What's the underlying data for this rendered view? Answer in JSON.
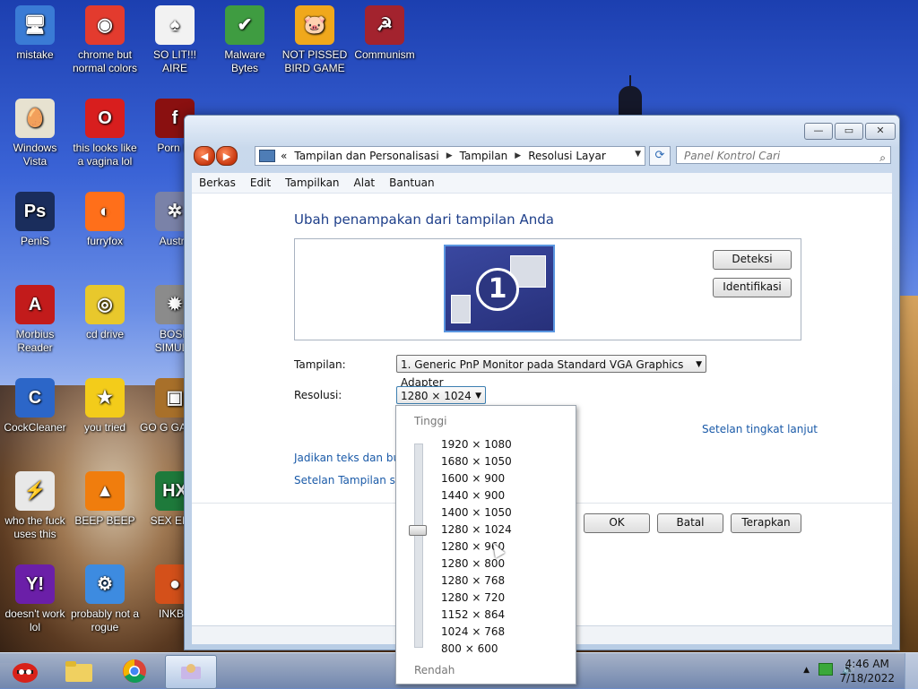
{
  "desktop": {
    "icons": [
      {
        "label": "mistake",
        "color": "#3a7bd5",
        "glyph": "🖥"
      },
      {
        "label": "chrome but normal colors",
        "color": "#e33b2e",
        "glyph": "◉"
      },
      {
        "label": "SO LIT!!! AIRE",
        "color": "#f2f2f2",
        "glyph": "♠"
      },
      {
        "label": "Malware Bytes",
        "color": "#3f9c41",
        "glyph": "✔"
      },
      {
        "label": "NOT PISSED BIRD GAME",
        "color": "#f0a81c",
        "glyph": "🐷"
      },
      {
        "label": "Communism",
        "color": "#a3232e",
        "glyph": "☭"
      },
      {
        "label": "Windows Vista",
        "color": "#e7e2d0",
        "glyph": "🥚"
      },
      {
        "label": "this looks like a vagina lol",
        "color": "#d81e1e",
        "glyph": "O"
      },
      {
        "label": "Porn Pl",
        "color": "#8a1010",
        "glyph": "f"
      },
      {
        "label": "PeniS",
        "color": "#1a2d5c",
        "glyph": "Ps"
      },
      {
        "label": "furryfox",
        "color": "#ff6f1a",
        "glyph": "◐"
      },
      {
        "label": "Austra",
        "color": "#7a82a8",
        "glyph": "✲"
      },
      {
        "label": "Morbius Reader",
        "color": "#c21b1b",
        "glyph": "A"
      },
      {
        "label": "cd drive",
        "color": "#e8c82c",
        "glyph": "◎"
      },
      {
        "label": "BOSN SIMULA",
        "color": "#8b8b8b",
        "glyph": "✹"
      },
      {
        "label": "CockCleaner",
        "color": "#2c66c8",
        "glyph": "C"
      },
      {
        "label": "you tried",
        "color": "#f3cc1a",
        "glyph": "★"
      },
      {
        "label": "GO G GADGE",
        "color": "#a8702a",
        "glyph": "▣"
      },
      {
        "label": "who the fuck uses this",
        "color": "#e8e8e8",
        "glyph": "⚡"
      },
      {
        "label": "BEEP BEEP",
        "color": "#f07d0d",
        "glyph": "▲"
      },
      {
        "label": "SEX EDIT",
        "color": "#1e7a3b",
        "glyph": "HX"
      },
      {
        "label": "doesn't work lol",
        "color": "#6b1fa8",
        "glyph": "Y!"
      },
      {
        "label": "probably not a rogue",
        "color": "#3d8be0",
        "glyph": "⚙"
      },
      {
        "label": "INKBA",
        "color": "#d4501a",
        "glyph": "●"
      }
    ]
  },
  "window": {
    "caption": {
      "minimize": "—",
      "maximize": "▭",
      "close": "✕"
    },
    "nav": {
      "back": "◀",
      "forward": "▶"
    },
    "breadcrumb": [
      "«",
      "Tampilan dan Personalisasi",
      "Tampilan",
      "Resolusi Layar"
    ],
    "search_placeholder": "Panel Kontrol Cari",
    "menu": [
      "Berkas",
      "Edit",
      "Tampilkan",
      "Alat",
      "Bantuan"
    ],
    "heading": "Ubah penampakan dari tampilan Anda",
    "monitor_number": "1",
    "buttons": {
      "detect": "Deteksi",
      "identify": "Identifikasi",
      "ok": "OK",
      "cancel": "Batal",
      "apply": "Terapkan"
    },
    "fields": {
      "display_label": "Tampilan:",
      "display_value": "1. Generic PnP Monitor pada Standard VGA Graphics Adapter",
      "resolution_label": "Resolusi:",
      "resolution_value": "1280 × 1024"
    },
    "links": {
      "advanced": "Setelan tingkat lanjut",
      "text_size": "Jadikan teks dan butir",
      "display_settings": "Setelan Tampilan sepe"
    }
  },
  "resolution_dropdown": {
    "high_label": "Tinggi",
    "low_label": "Rendah",
    "options": [
      "1920 × 1080",
      "1680 × 1050",
      "1600 × 900",
      "1440 × 900",
      "1400 × 1050",
      "1280 × 1024",
      "1280 × 960",
      "1280 × 800",
      "1280 × 768",
      "1280 × 720",
      "1152 × 864",
      "1024 × 768",
      "800 × 600"
    ],
    "selected_index": 5
  },
  "taskbar": {
    "items": [
      "angry-birds",
      "folder",
      "chrome",
      "active-app"
    ],
    "tray": {
      "arrow": "▲",
      "network": "▣",
      "volume": "🔊"
    },
    "time": "4:46 AM",
    "date": "7/18/2022"
  }
}
